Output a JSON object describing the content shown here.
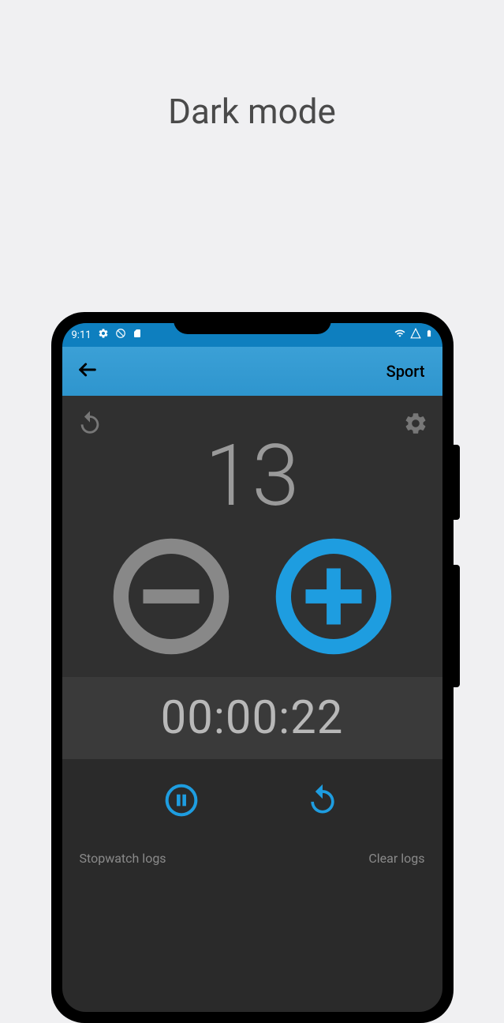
{
  "page": {
    "title": "Dark mode"
  },
  "status": {
    "time": "9:11"
  },
  "appbar": {
    "title": "Sport"
  },
  "counter": {
    "value": "13"
  },
  "timer": {
    "elapsed": "00:00:22"
  },
  "logs": {
    "label": "Stopwatch logs",
    "clear": "Clear logs"
  },
  "colors": {
    "accent": "#1e9de0",
    "muted": "#888888"
  }
}
